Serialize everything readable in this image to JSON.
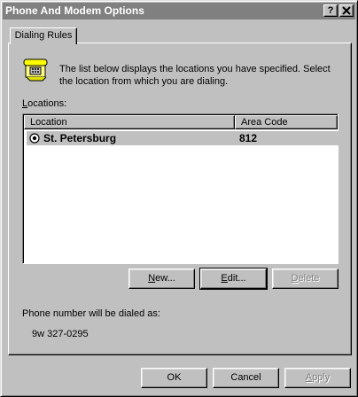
{
  "window": {
    "title": "Phone And Modem Options",
    "help_label": "?",
    "close_label": "✕"
  },
  "tabs": [
    {
      "label": "Dialing Rules"
    }
  ],
  "dialing_rules": {
    "description": "The list below displays the locations you have specified. Select the location from which you are dialing.",
    "locations_label": "Locations:",
    "columns": {
      "location": "Location",
      "area_code": "Area Code"
    },
    "rows": [
      {
        "location": "St. Petersburg",
        "area_code": "812",
        "selected": true
      }
    ],
    "buttons": {
      "new": "New...",
      "edit": "Edit...",
      "delete": "Delete"
    },
    "dial_label": "Phone number will be dialed as:",
    "dial_number": "9w 327-0295"
  },
  "footer": {
    "ok": "OK",
    "cancel": "Cancel",
    "apply": "Apply"
  },
  "icons": {
    "phone": "telephone-icon",
    "radio": "selected-radio-icon"
  }
}
